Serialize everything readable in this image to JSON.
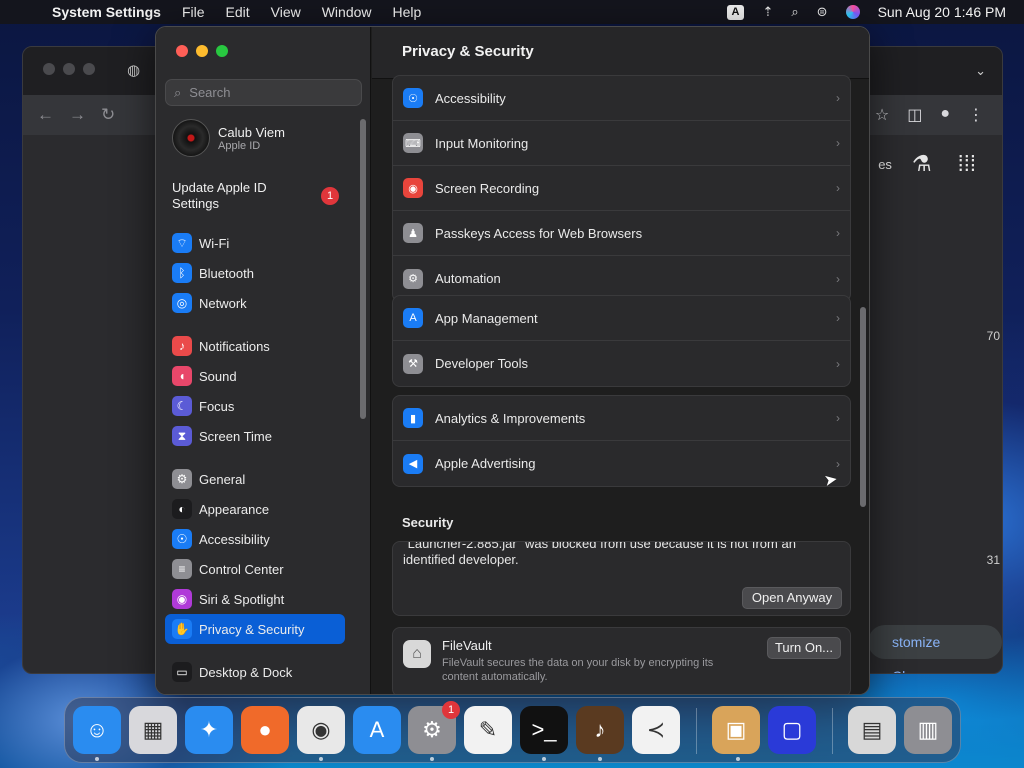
{
  "menubar": {
    "app_name": "System Settings",
    "menus": [
      "File",
      "Edit",
      "View",
      "Window",
      "Help"
    ],
    "input_badge": "A",
    "clock": "Sun Aug 20  1:46 PM"
  },
  "chrome": {
    "newtab_text_fragment": "es",
    "customize_label": "stomize Chrome",
    "side_numbers": [
      "70",
      "31"
    ]
  },
  "settings": {
    "search_placeholder": "Search",
    "profile": {
      "name": "Calub Viem",
      "subtitle": "Apple ID"
    },
    "update_text": "Update Apple ID Settings",
    "update_badge": "1",
    "sidebar_items": [
      {
        "label": "Wi-Fi",
        "icon": "wifi-icon",
        "color": "#1a7cf5"
      },
      {
        "label": "Bluetooth",
        "icon": "bluetooth-icon",
        "color": "#1a7cf5"
      },
      {
        "label": "Network",
        "icon": "globe-icon",
        "color": "#1a7cf5"
      },
      {
        "label": "Notifications",
        "icon": "bell-icon",
        "color": "#ea4a4a"
      },
      {
        "label": "Sound",
        "icon": "speaker-icon",
        "color": "#e8476a"
      },
      {
        "label": "Focus",
        "icon": "moon-icon",
        "color": "#5b5bd6"
      },
      {
        "label": "Screen Time",
        "icon": "hourglass-icon",
        "color": "#5b5bd6"
      },
      {
        "label": "General",
        "icon": "gear-icon",
        "color": "#8e8e93"
      },
      {
        "label": "Appearance",
        "icon": "appearance-icon",
        "color": "#1c1c1e"
      },
      {
        "label": "Accessibility",
        "icon": "accessibility-icon",
        "color": "#1a7cf5"
      },
      {
        "label": "Control Center",
        "icon": "control-center-icon",
        "color": "#8e8e93"
      },
      {
        "label": "Siri & Spotlight",
        "icon": "siri-icon",
        "color": "#b03ad8"
      },
      {
        "label": "Privacy & Security",
        "icon": "hand-icon",
        "color": "#1a7cf5"
      },
      {
        "label": "Desktop & Dock",
        "icon": "dock-icon",
        "color": "#1c1c1e"
      }
    ],
    "content_title": "Privacy & Security",
    "group1": [
      {
        "label": "Accessibility",
        "icon": "accessibility-icon",
        "color": "#1a7cf5"
      },
      {
        "label": "Input Monitoring",
        "icon": "keyboard-icon",
        "color": "#8e8e93"
      },
      {
        "label": "Screen Recording",
        "icon": "record-icon",
        "color": "#e8453c"
      },
      {
        "label": "Passkeys Access for Web Browsers",
        "icon": "person-icon",
        "color": "#8e8e93"
      },
      {
        "label": "Automation",
        "icon": "gear-icon",
        "color": "#8e8e93"
      }
    ],
    "group2": [
      {
        "label": "App Management",
        "icon": "app-store-icon",
        "color": "#1a7cf5"
      },
      {
        "label": "Developer Tools",
        "icon": "hammer-icon",
        "color": "#8e8e93"
      }
    ],
    "group3": [
      {
        "label": "Analytics & Improvements",
        "icon": "chart-icon",
        "color": "#1a7cf5"
      },
      {
        "label": "Apple Advertising",
        "icon": "megaphone-icon",
        "color": "#1a7cf5"
      }
    ],
    "security_title": "Security",
    "security_message": "\"Launcher-2.885.jar\" was blocked from use because it is not from an identified developer.",
    "open_anyway": "Open Anyway",
    "filevault_title": "FileVault",
    "filevault_desc": "FileVault secures the data on your disk by encrypting its content automatically.",
    "turn_on": "Turn On..."
  },
  "dock": {
    "items": [
      {
        "name": "finder-icon",
        "glyph": "☺",
        "bg": "#2a8cf0"
      },
      {
        "name": "launchpad-icon",
        "glyph": "▦",
        "bg": "#d8d8dc"
      },
      {
        "name": "safari-icon",
        "glyph": "✦",
        "bg": "#2a8cf0"
      },
      {
        "name": "firefox-icon",
        "glyph": "●",
        "bg": "#f06a2a"
      },
      {
        "name": "chrome-icon",
        "glyph": "◉",
        "bg": "#e8e8e8"
      },
      {
        "name": "app-store-icon",
        "glyph": "A",
        "bg": "#2a8cf0"
      },
      {
        "name": "system-settings-icon",
        "glyph": "⚙",
        "bg": "#8e8e93"
      },
      {
        "name": "textedit-icon",
        "glyph": "✎",
        "bg": "#f2f2f2"
      },
      {
        "name": "terminal-icon",
        "glyph": ">_",
        "bg": "#111"
      },
      {
        "name": "guitar-icon",
        "glyph": "♪",
        "bg": "#5a3a20"
      },
      {
        "name": "vscode-icon",
        "glyph": "≺",
        "bg": "#f2f2f2"
      },
      {
        "name": "installer-icon",
        "glyph": "▣",
        "bg": "#d9a45a"
      },
      {
        "name": "sequence-icon",
        "glyph": "▢",
        "bg": "#2a3ad8"
      },
      {
        "name": "archive-icon",
        "glyph": "▤",
        "bg": "#d8d8d8"
      },
      {
        "name": "trash-icon",
        "glyph": "▥",
        "bg": "#8e8e93"
      }
    ],
    "settings_badge": "1"
  }
}
